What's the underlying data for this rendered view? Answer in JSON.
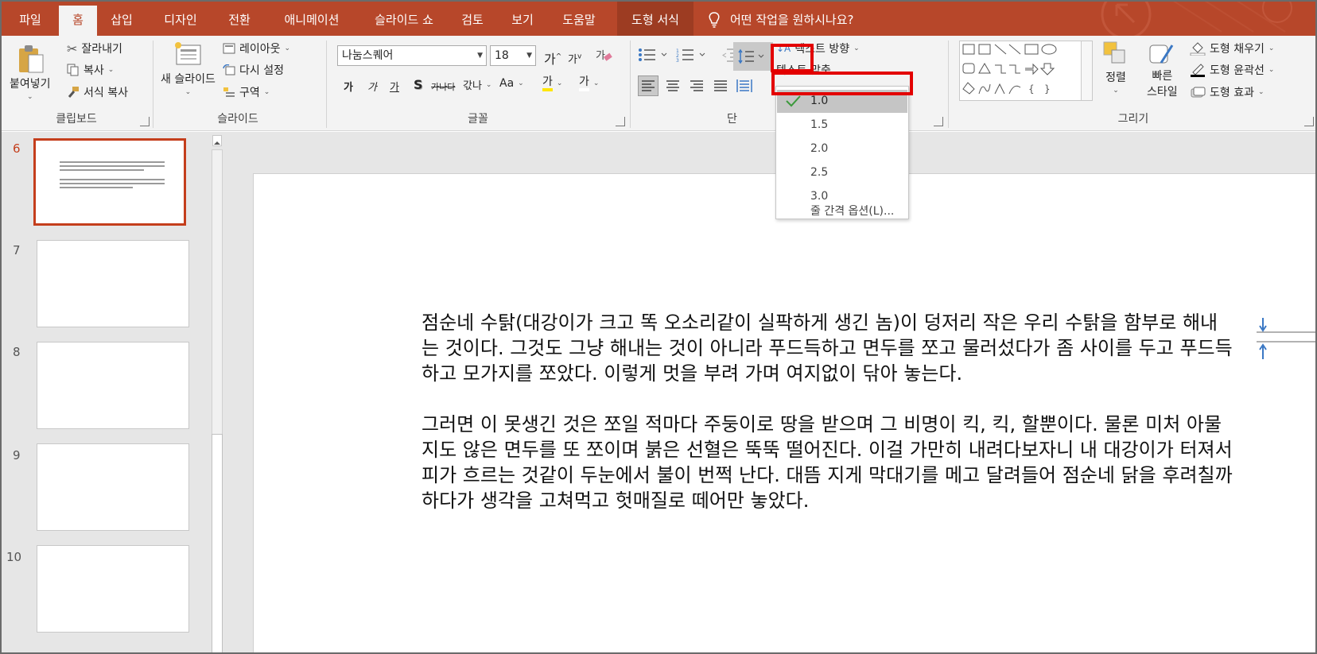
{
  "tabs": {
    "file": "파일",
    "home": "홈",
    "insert": "삽입",
    "design": "디자인",
    "transitions": "전환",
    "animations": "애니메이션",
    "slideshow": "슬라이드 쇼",
    "review": "검토",
    "view": "보기",
    "help": "도움말",
    "shape_format": "도형 서식",
    "tell_me": "어떤 작업을 원하시나요?"
  },
  "clipboard": {
    "paste": "붙여넣기",
    "cut": "잘라내기",
    "copy": "복사",
    "format_painter": "서식 복사",
    "label": "클립보드"
  },
  "slides_group": {
    "new_slide": "새 슬라이드",
    "layout": "레이아웃",
    "reset": "다시 설정",
    "section": "구역",
    "label": "슬라이드"
  },
  "font": {
    "name": "나눔스퀘어",
    "size": "18",
    "label": "글꼴",
    "grow": "가",
    "shrink": "가",
    "bold": "가",
    "italic": "가",
    "underline": "가",
    "shadow": "S",
    "strike": "가나다",
    "spacing": "갃나",
    "case": "Aa",
    "highlight": "가",
    "color": "가"
  },
  "paragraph": {
    "label": "단",
    "text_direction": "텍스트 방향",
    "align_text": "텍스트 맞춤"
  },
  "drawing": {
    "arrange": "정렬",
    "quick_styles_1": "빠른",
    "quick_styles_2": "스타일",
    "shape_fill": "도형 채우기",
    "shape_outline": "도형 윤곽선",
    "shape_effects": "도형 효과",
    "label": "그리기"
  },
  "line_spacing_menu": {
    "options": [
      "1.0",
      "1.5",
      "2.0",
      "2.5",
      "3.0"
    ],
    "selected": "1.0",
    "more": "줄 간격 옵션(L)..."
  },
  "slide_panel": {
    "numbers": [
      "6",
      "7",
      "8",
      "9",
      "10"
    ],
    "current": "6"
  },
  "slide_body": {
    "paragraphs": [
      "점순네 수탉(대강이가 크고 똑 오소리같이 실팍하게 생긴 놈)이 덩저리 작은 우리 수탉을 함부로 해내는 것이다. 그것도 그냥 해내는 것이 아니라 푸드득하고 면두를 쪼고 물러섰다가 좀 사이를 두고 푸드득하고 모가지를 쪼았다. 이렇게 멋을 부려 가며 여지없이 닦아 놓는다.",
      "그러면 이 못생긴 것은 쪼일 적마다 주둥이로 땅을 받으며 그 비명이 킥, 킥, 할뿐이다. 물론 미처 아물지도 않은 면두를 또 쪼이며 붉은 선혈은 뚝뚝 떨어진다. 이걸 가만히 내려다보자니 내 대강이가 터져서 피가 흐르는 것같이 두눈에서 불이 번쩍 난다. 대뜸 지게 막대기를 메고 달려들어 점순네 닭을 후려칠까 하다가 생각을 고쳐먹고 헛매질로 떼어만 놓았다."
    ]
  },
  "colors": {
    "accent": "#b7472a",
    "selection_red": "#e30000",
    "check_green": "#3c9a3c"
  }
}
